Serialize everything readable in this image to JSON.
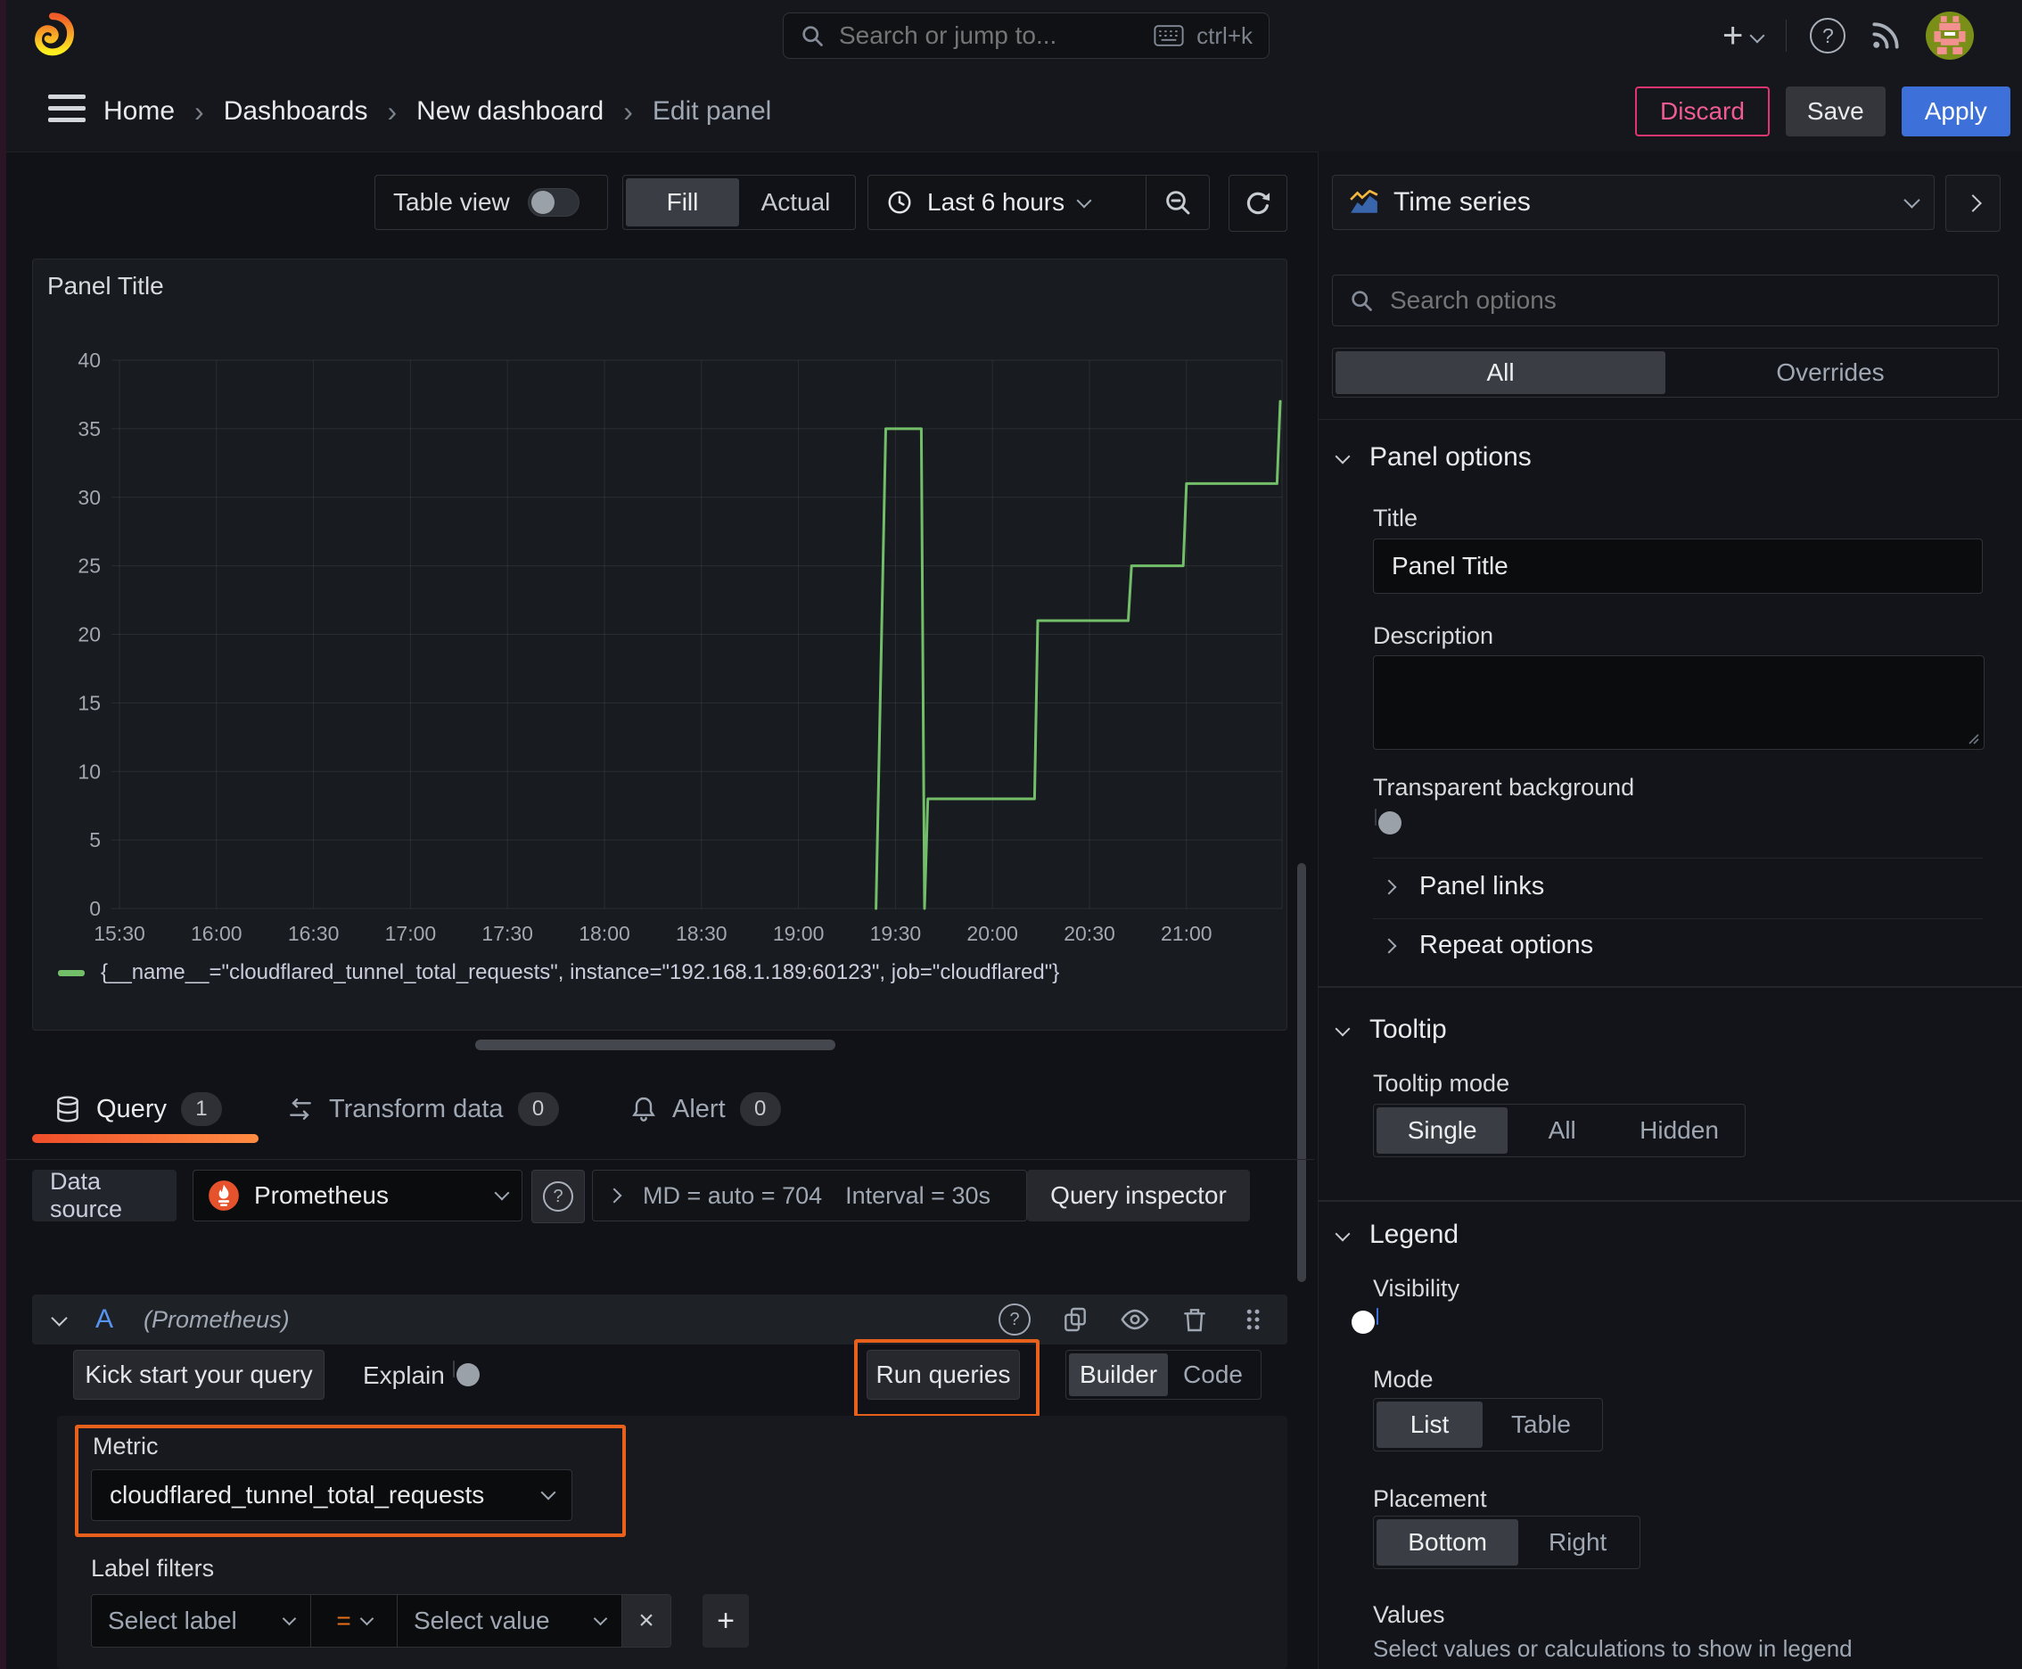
{
  "topbar": {
    "search_placeholder": "Search or jump to...",
    "shortcut": "ctrl+k"
  },
  "breadcrumb": {
    "items": [
      "Home",
      "Dashboards",
      "New dashboard",
      "Edit panel"
    ]
  },
  "actions": {
    "discard": "Discard",
    "save": "Save",
    "apply": "Apply"
  },
  "toolbar": {
    "table_view": "Table view",
    "fill": "Fill",
    "actual": "Actual",
    "time_range": "Last 6 hours"
  },
  "panel": {
    "title": "Panel Title",
    "legend": "{__name__=\"cloudflared_tunnel_total_requests\", instance=\"192.168.1.189:60123\", job=\"cloudflared\"}"
  },
  "chart_data": {
    "type": "line",
    "title": "Panel Title",
    "xlabel": "",
    "ylabel": "",
    "ylim": [
      0,
      40
    ],
    "grid": true,
    "legend_position": "bottom",
    "x_ticks": [
      "15:30",
      "16:00",
      "16:30",
      "17:00",
      "17:30",
      "18:00",
      "18:30",
      "19:00",
      "19:30",
      "20:00",
      "20:30",
      "21:00"
    ],
    "y_ticks": [
      0,
      5,
      10,
      15,
      20,
      25,
      30,
      35,
      40
    ],
    "series": [
      {
        "name": "{__name__=\"cloudflared_tunnel_total_requests\", instance=\"192.168.1.189:60123\", job=\"cloudflared\"}",
        "color": "#73bf69",
        "points": [
          [
            "19:24",
            0
          ],
          [
            "19:27",
            35
          ],
          [
            "19:38",
            35
          ],
          [
            "19:39",
            0
          ],
          [
            "19:40",
            8
          ],
          [
            "20:13",
            8
          ],
          [
            "20:14",
            21
          ],
          [
            "20:42",
            21
          ],
          [
            "20:43",
            25
          ],
          [
            "20:59",
            25
          ],
          [
            "21:00",
            31
          ],
          [
            "21:28",
            31
          ],
          [
            "21:29",
            37
          ]
        ]
      }
    ]
  },
  "tabs": {
    "query": {
      "label": "Query",
      "count": "1"
    },
    "transform": {
      "label": "Transform data",
      "count": "0"
    },
    "alert": {
      "label": "Alert",
      "count": "0"
    }
  },
  "datasource": {
    "label": "Data source",
    "name": "Prometheus",
    "stats": "MD = auto = 704",
    "interval": "Interval = 30s",
    "inspector": "Query inspector"
  },
  "query": {
    "ref": "A",
    "ds_hint": "(Prometheus)",
    "kickstart": "Kick start your query",
    "explain": "Explain",
    "run": "Run queries",
    "builder": "Builder",
    "code": "Code",
    "metric": {
      "label": "Metric",
      "value": "cloudflared_tunnel_total_requests"
    },
    "filters": {
      "label": "Label filters",
      "select_label": "Select label",
      "operator": "=",
      "select_value": "Select value"
    }
  },
  "options": {
    "viz": "Time series",
    "search_placeholder": "Search options",
    "tab_all": "All",
    "tab_overrides": "Overrides",
    "panel_options": {
      "header": "Panel options",
      "title_label": "Title",
      "title_value": "Panel Title",
      "description_label": "Description",
      "transparent_label": "Transparent background"
    },
    "panel_links": "Panel links",
    "repeat_options": "Repeat options",
    "tooltip": {
      "header": "Tooltip",
      "mode_label": "Tooltip mode",
      "single": "Single",
      "all": "All",
      "hidden": "Hidden"
    },
    "legend": {
      "header": "Legend",
      "visibility": "Visibility",
      "mode_label": "Mode",
      "list": "List",
      "table": "Table",
      "placement": "Placement",
      "bottom": "Bottom",
      "right": "Right",
      "values_label": "Values",
      "values_help": "Select values or calculations to show in legend"
    }
  },
  "colors": {
    "accent_orange": "#e8611c",
    "series_green": "#73bf69",
    "primary_blue": "#3d71d9",
    "danger_pink": "#e0356f"
  }
}
